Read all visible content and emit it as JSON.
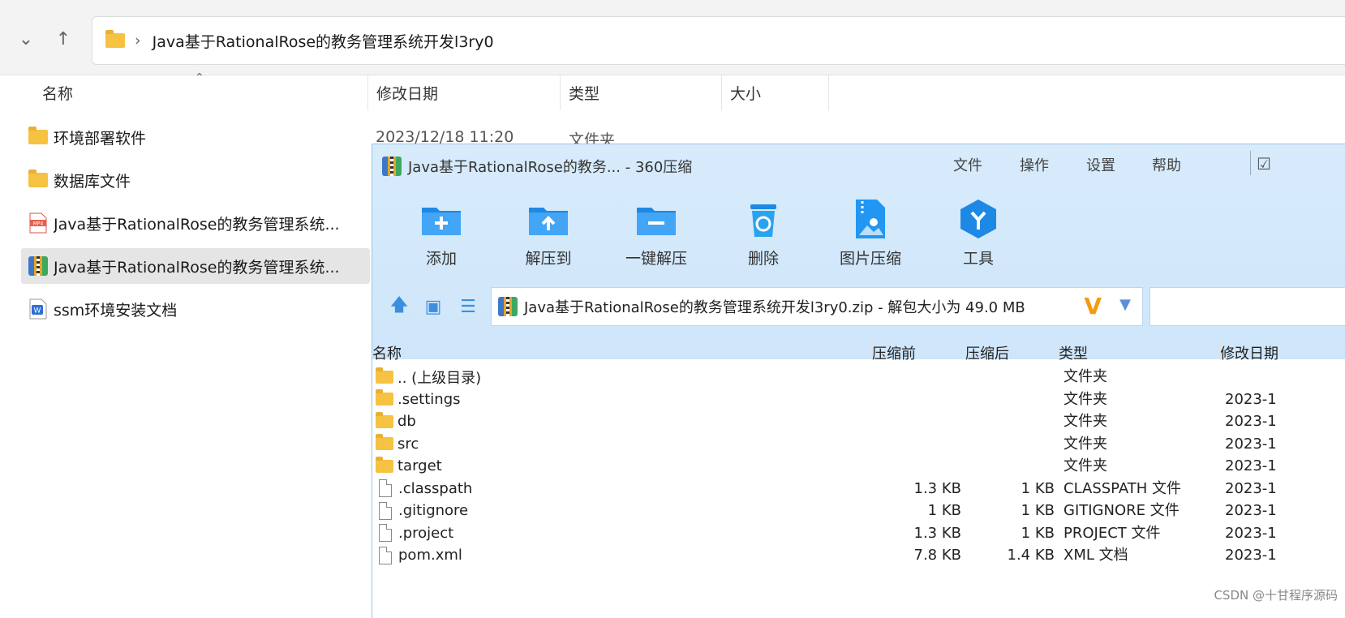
{
  "explorer": {
    "path_segment": "Java基于RationalRose的教务管理系统开发l3ry0",
    "columns": [
      "名称",
      "修改日期",
      "类型",
      "大小"
    ],
    "rows": [
      {
        "name": "环境部署软件",
        "date": "2023/12/18 11:20",
        "type": "文件夹",
        "icon": "folder-icon"
      },
      {
        "name": "数据库文件",
        "icon": "folder-icon"
      },
      {
        "name": "Java基于RationalRose的教务管理系统...",
        "icon": "mp4-file-icon"
      },
      {
        "name": "Java基于RationalRose的教务管理系统...",
        "icon": "zip-archive-icon",
        "selected": true
      },
      {
        "name": "ssm环境安装文档",
        "icon": "word-doc-icon"
      }
    ]
  },
  "zip": {
    "title": "Java基于RationalRose的教务... - 360压缩",
    "menu": [
      "文件",
      "操作",
      "设置",
      "帮助"
    ],
    "tools": [
      {
        "label": "添加",
        "icon": "add-folder-icon"
      },
      {
        "label": "解压到",
        "icon": "extract-to-icon"
      },
      {
        "label": "一键解压",
        "icon": "one-click-extract-icon"
      },
      {
        "label": "删除",
        "icon": "recycle-bin-icon"
      },
      {
        "label": "图片压缩",
        "icon": "image-compress-icon"
      },
      {
        "label": "工具",
        "icon": "tools-icon"
      }
    ],
    "path": "Java基于RationalRose的教务管理系统开发l3ry0.zip - 解包大小为 49.0 MB",
    "columns": [
      "名称",
      "压缩前",
      "压缩后",
      "类型",
      "修改日期"
    ],
    "rows": [
      {
        "name": ".. (上级目录)",
        "before": "",
        "after": "",
        "type": "文件夹",
        "date": "",
        "icon": "folder"
      },
      {
        "name": ".settings",
        "before": "",
        "after": "",
        "type": "文件夹",
        "date": "2023-1",
        "icon": "folder"
      },
      {
        "name": "db",
        "before": "",
        "after": "",
        "type": "文件夹",
        "date": "2023-1",
        "icon": "folder"
      },
      {
        "name": "src",
        "before": "",
        "after": "",
        "type": "文件夹",
        "date": "2023-1",
        "icon": "folder"
      },
      {
        "name": "target",
        "before": "",
        "after": "",
        "type": "文件夹",
        "date": "2023-1",
        "icon": "folder"
      },
      {
        "name": ".classpath",
        "before": "1.3 KB",
        "after": "1 KB",
        "type": "CLASSPATH 文件",
        "date": "2023-1",
        "icon": "file"
      },
      {
        "name": ".gitignore",
        "before": "1 KB",
        "after": "1 KB",
        "type": "GITIGNORE 文件",
        "date": "2023-1",
        "icon": "file"
      },
      {
        "name": ".project",
        "before": "1.3 KB",
        "after": "1 KB",
        "type": "PROJECT 文件",
        "date": "2023-1",
        "icon": "file"
      },
      {
        "name": "pom.xml",
        "before": "7.8 KB",
        "after": "1.4 KB",
        "type": "XML 文档",
        "date": "2023-1",
        "icon": "file"
      }
    ]
  },
  "watermark": "CSDN @十甘程序源码"
}
